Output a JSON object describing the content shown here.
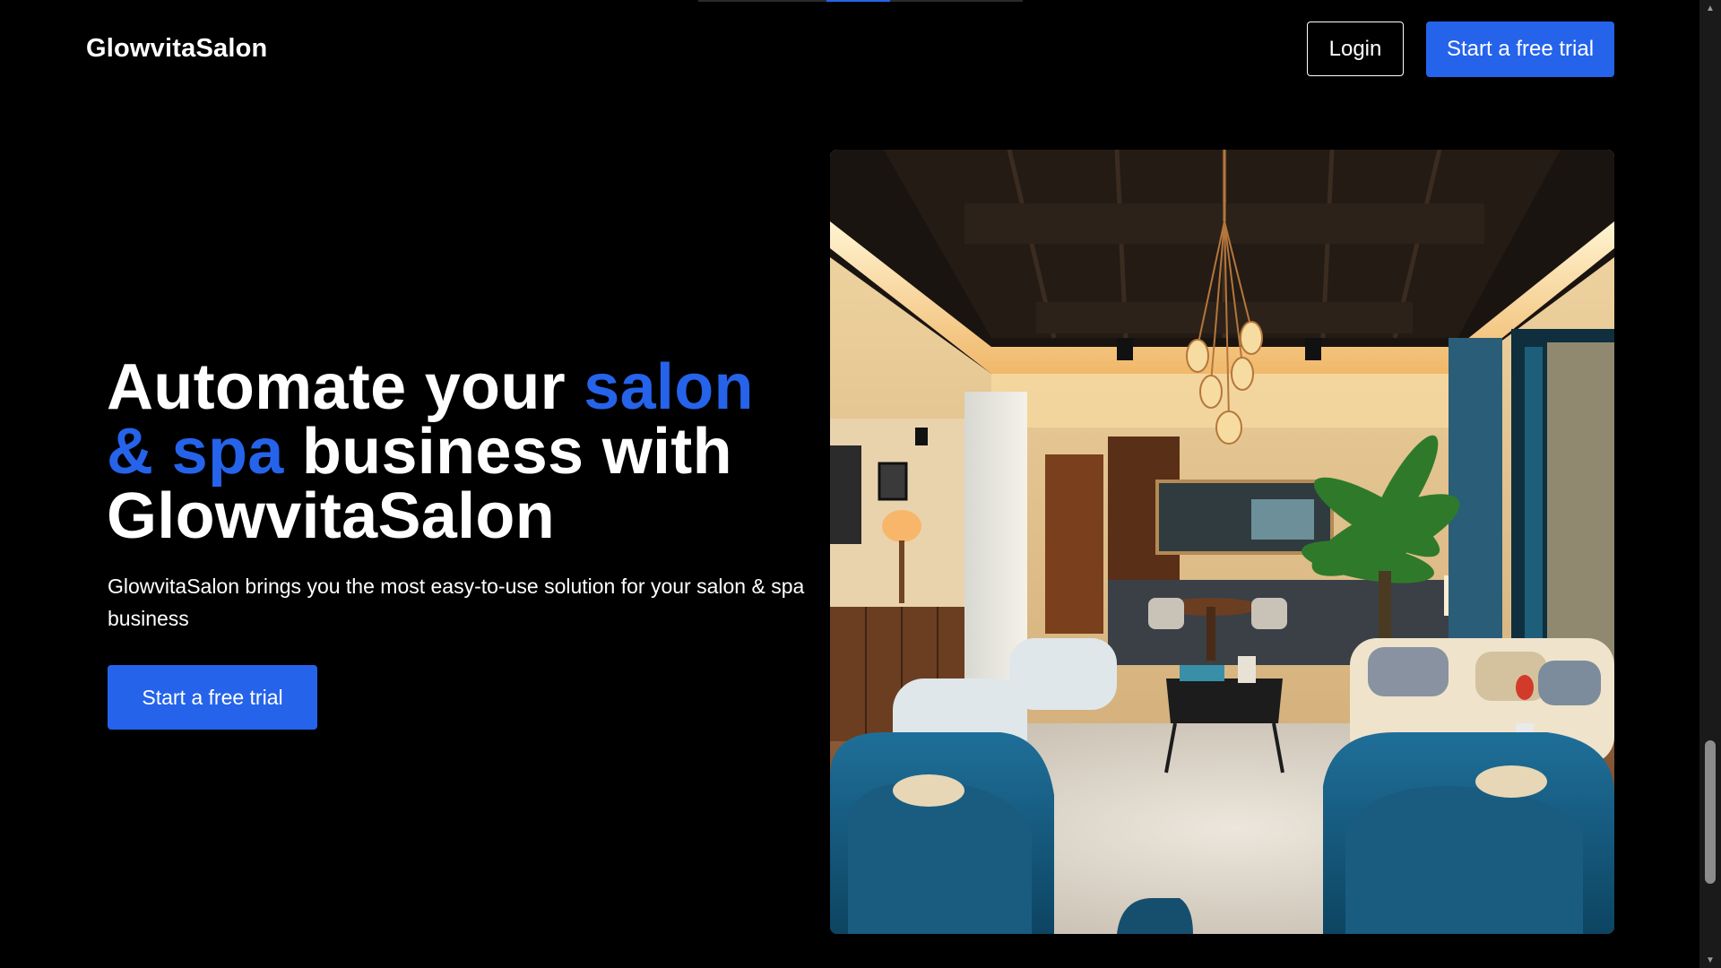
{
  "header": {
    "brand": "GlowvitaSalon",
    "login_label": "Login",
    "trial_label": "Start a free trial"
  },
  "hero": {
    "title_part1": "Automate your ",
    "title_accent": "salon & spa",
    "title_part2": " business with GlowvitaSalon",
    "subtitle": "GlowvitaSalon brings you the most easy-to-use solution for your salon & spa business",
    "cta_label": "Start a free trial",
    "image_icon": "salon-lounge-photo"
  },
  "colors": {
    "background": "#000000",
    "accent": "#2563eb",
    "text": "#ffffff",
    "scrollbar_track": "#1a1a1a",
    "scrollbar_thumb": "#8c8c8c"
  },
  "scrollbar": {
    "up_icon": "▲",
    "down_icon": "▼"
  }
}
